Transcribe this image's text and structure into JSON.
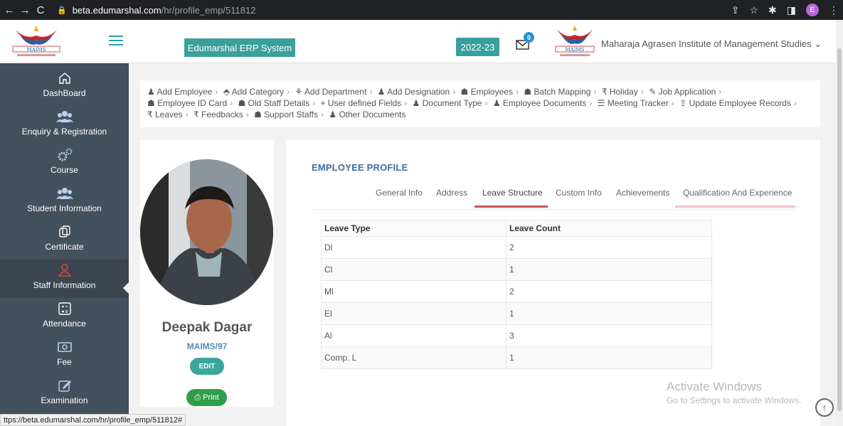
{
  "browser": {
    "url_domain": "beta.edumarshal.com",
    "url_path": "/hr/profile_emp/511812",
    "profile_initial": "E"
  },
  "header": {
    "logo_text": "MAIMS",
    "erp_title": "Edumarshal ERP System",
    "session_year": "2022-23",
    "notification_count": "0",
    "institute_name": "Maharaja Agrasen Institute of Management Studies",
    "institute_chevron": "⌄"
  },
  "sidebar": {
    "items": [
      {
        "label": "DashBoard",
        "icon": "home-icon"
      },
      {
        "label": "Enquiry & Registration",
        "icon": "users-icon"
      },
      {
        "label": "Course",
        "icon": "gears-icon"
      },
      {
        "label": "Student Information",
        "icon": "users-icon"
      },
      {
        "label": "Certificate",
        "icon": "copy-icon"
      },
      {
        "label": "Staff Information",
        "icon": "user-icon"
      },
      {
        "label": "Attendance",
        "icon": "calculator-icon"
      },
      {
        "label": "Fee",
        "icon": "money-icon"
      },
      {
        "label": "Examination",
        "icon": "edit-icon"
      }
    ],
    "active": "Staff Information"
  },
  "breadcrumbs": [
    {
      "label": "Add Employee",
      "icon": "user-icon"
    },
    {
      "label": "Add Category",
      "icon": "tag-icon"
    },
    {
      "label": "Add Department",
      "icon": "sitemap-icon"
    },
    {
      "label": "Add Designation",
      "icon": "user-icon"
    },
    {
      "label": "Employees",
      "icon": "users-icon"
    },
    {
      "label": "Batch Mapping",
      "icon": "users-icon"
    },
    {
      "label": "Holiday",
      "icon": "rupee-icon"
    },
    {
      "label": "Job Application",
      "icon": "edit-icon"
    },
    {
      "label": "Employee ID Card",
      "icon": "users-icon"
    },
    {
      "label": "Old Staff Details",
      "icon": "users-icon"
    },
    {
      "label": "User defined Fields",
      "icon": "plus-icon"
    },
    {
      "label": "Document Type",
      "icon": "user-icon"
    },
    {
      "label": "Employee Documents",
      "icon": "user-icon"
    },
    {
      "label": "Meeting Tracker",
      "icon": "list-icon"
    },
    {
      "label": "Update Employee Records",
      "icon": "upload-icon"
    },
    {
      "label": "Leaves",
      "icon": "rupee-icon"
    },
    {
      "label": "Feedbacks",
      "icon": "rupee-icon"
    },
    {
      "label": "Support Staffs",
      "icon": "users-icon"
    },
    {
      "label": "Other Documents",
      "icon": "user-icon"
    }
  ],
  "profile": {
    "name": "Deepak Dagar",
    "code": "MAIMS/97",
    "edit_label": "EDIT",
    "print_label": "Print"
  },
  "main": {
    "section_title": "EMPLOYEE PROFILE",
    "tabs": [
      {
        "label": "General Info"
      },
      {
        "label": "Address"
      },
      {
        "label": "Leave Structure"
      },
      {
        "label": "Custom Info"
      },
      {
        "label": "Achievements"
      },
      {
        "label": "Qualification And Experience"
      }
    ],
    "active_tab": "Leave Structure",
    "table": {
      "headers": [
        "Leave Type",
        "Leave Count"
      ],
      "rows": [
        [
          "Dl",
          "2"
        ],
        [
          "Cl",
          "1"
        ],
        [
          "Ml",
          "2"
        ],
        [
          "El",
          "1"
        ],
        [
          "Al",
          "3"
        ],
        [
          "Comp. L",
          "1"
        ]
      ]
    }
  },
  "watermark": {
    "line1": "Activate Windows",
    "line2": "Go to Settings to activate Windows."
  },
  "status_bar": {
    "url": "ttps://beta.edumarshal.com/hr/profile_emp/511812#"
  },
  "colors": {
    "teal": "#3aa09d",
    "sidebar": "#43505e",
    "tab_underline_active": "#c9555a",
    "tab_underline_hover": "#f0c4c6"
  }
}
